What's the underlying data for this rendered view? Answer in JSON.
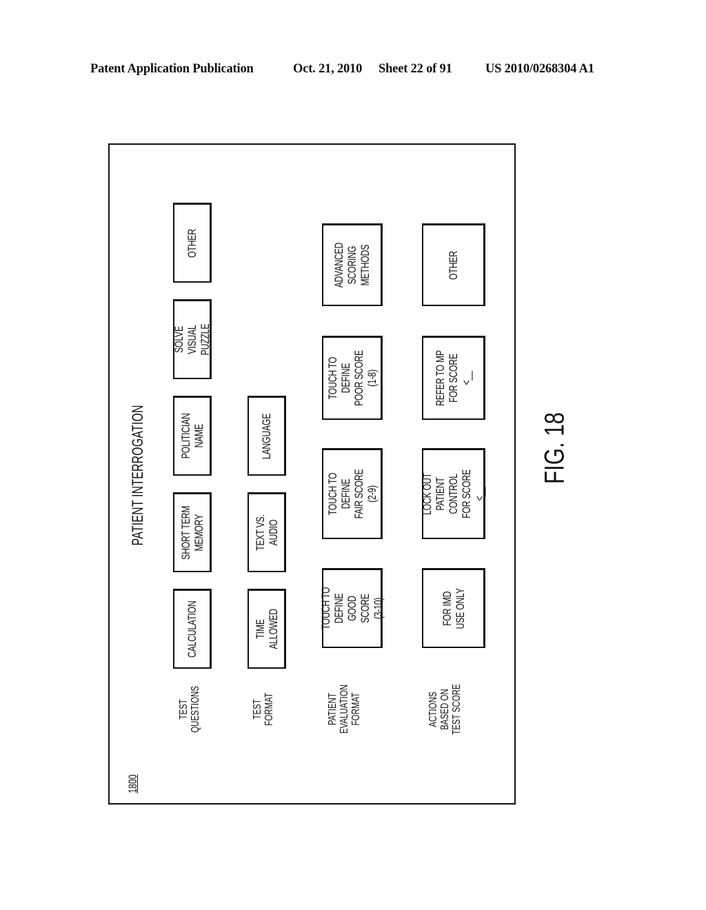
{
  "header": {
    "publication": "Patent Application Publication",
    "date": "Oct. 21, 2010",
    "sheet": "Sheet 22 of 91",
    "patent_number": "US 2010/0268304 A1"
  },
  "figure": {
    "label": "FIG. 18",
    "reference_number": "1800",
    "screen_title": "PATIENT INTERROGATION",
    "rows": [
      {
        "label": "TEST\nQUESTIONS",
        "buttons": [
          "CALCULATION",
          "SHORT TERM\nMEMORY",
          "POLITICIAN\nNAME",
          "SOLVE VISUAL\nPUZZLE",
          "OTHER"
        ]
      },
      {
        "label": "TEST\nFORMAT",
        "buttons": [
          "TIME\nALLOWED",
          "TEXT VS.\nAUDIO",
          "LANGUAGE"
        ]
      },
      {
        "label": "PATIENT\nEVALUATION\nFORMAT",
        "buttons": [
          "TOUCH TO DEFINE\nGOOD SCORE\n(3-10)",
          "TOUCH TO DEFINE\nFAIR SCORE\n(2-9)",
          "TOUCH TO DEFINE\nPOOR SCORE\n(1-8)",
          "ADVANCED\nSCORING\nMETHODS"
        ]
      },
      {
        "label": "ACTIONS\nBASED ON\nTEST SCORE",
        "buttons": [
          "FOR IMD\nUSE ONLY",
          "LOCK OUT\nPATIENT CONTROL\nFOR SCORE <__",
          "REFER TO MP\nFOR SCORE <__",
          "OTHER"
        ]
      }
    ]
  }
}
